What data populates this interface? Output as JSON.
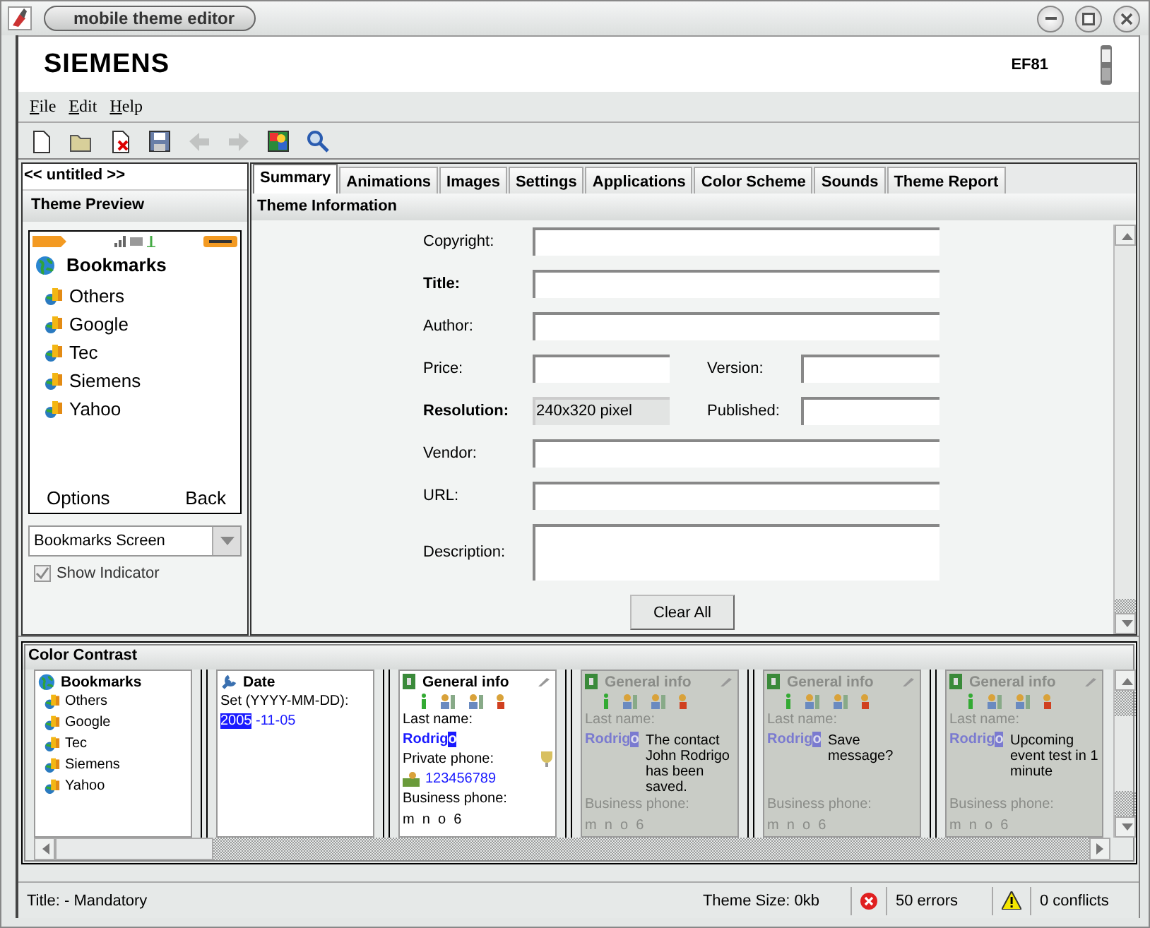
{
  "window": {
    "title": "mobile theme editor"
  },
  "banner": {
    "brand": "SIEMENS",
    "model": "EF81"
  },
  "menu": [
    "File",
    "Edit",
    "Help"
  ],
  "toolbar": [
    {
      "kind": "new",
      "disabled": false
    },
    {
      "kind": "open",
      "disabled": false
    },
    {
      "kind": "delete",
      "disabled": false
    },
    {
      "kind": "save",
      "disabled": false
    },
    {
      "kind": "back",
      "disabled": true
    },
    {
      "kind": "forward",
      "disabled": true
    },
    {
      "kind": "preview",
      "disabled": false
    },
    {
      "kind": "search",
      "disabled": false
    }
  ],
  "document": {
    "name": "<< untitled >>"
  },
  "preview": {
    "title": "Theme Preview",
    "screen": {
      "title": "Bookmarks",
      "items": [
        "Others",
        "Google",
        "Tec",
        "Siemens",
        "Yahoo"
      ],
      "softkeys": [
        "Options",
        "Back"
      ]
    },
    "screen_select": {
      "value": "Bookmarks Screen"
    },
    "show_indicator": {
      "label": "Show Indicator",
      "checked": true
    }
  },
  "tabs": [
    {
      "label": "Summary",
      "selected": true
    },
    {
      "label": "Animations",
      "selected": false
    },
    {
      "label": "Images",
      "selected": false
    },
    {
      "label": "Settings",
      "selected": false
    },
    {
      "label": "Applications",
      "selected": false
    },
    {
      "label": "Color Scheme",
      "selected": false
    },
    {
      "label": "Sounds",
      "selected": false
    },
    {
      "label": "Theme Report",
      "selected": false
    }
  ],
  "summary": {
    "title": "Theme Information",
    "rows": [
      {
        "kind": "wide",
        "fields": [
          {
            "label": "Copyright:",
            "bold": false,
            "readonly": false
          }
        ]
      },
      {
        "kind": "wide",
        "fields": [
          {
            "label": "Title:",
            "bold": true,
            "readonly": false
          }
        ]
      },
      {
        "kind": "wide",
        "fields": [
          {
            "label": "Author:",
            "bold": false,
            "readonly": false
          }
        ]
      },
      {
        "kind": "pair",
        "fields": [
          {
            "label": "Price:",
            "bold": false,
            "readonly": false
          },
          {
            "label": "Version:",
            "bold": false,
            "readonly": false
          }
        ]
      },
      {
        "kind": "pair",
        "fields": [
          {
            "label": "Resolution:",
            "bold": true,
            "readonly": true,
            "value": "240x320 pixel"
          },
          {
            "label": "Published:",
            "bold": false,
            "readonly": false
          }
        ]
      },
      {
        "kind": "wide",
        "fields": [
          {
            "label": "Vendor:",
            "bold": false,
            "readonly": false
          }
        ]
      },
      {
        "kind": "wide",
        "fields": [
          {
            "label": "URL:",
            "bold": false,
            "readonly": false
          }
        ]
      },
      {
        "kind": "area",
        "fields": [
          {
            "label": "Description:",
            "bold": false,
            "readonly": false
          }
        ]
      }
    ],
    "button": "Clear All"
  },
  "color_contrast": {
    "title": "Color Contrast",
    "panels": [
      {
        "kind": "list",
        "dimmed": false,
        "title": "Bookmarks",
        "items": [
          "Others",
          "Google",
          "Tec",
          "Siemens",
          "Yahoo"
        ]
      },
      {
        "kind": "date",
        "dimmed": false,
        "title": "Date",
        "label": "Set (YYYY-MM-DD):",
        "selected_part": "2005",
        "rest": "-11-05"
      },
      {
        "kind": "contact",
        "dimmed": false,
        "title": "General info",
        "last_name_label": "Last name:",
        "name": "Rodrig",
        "cursor": "o",
        "private_label": "Private phone:",
        "phone": "123456789",
        "business_label": "Business phone:",
        "keys": "m  n  o  6"
      },
      {
        "kind": "contact",
        "dimmed": true,
        "title": "General info",
        "last_name_label": "Last name:",
        "name": "Rodrig",
        "cursor": "o",
        "business_label": "Business phone:",
        "keys": "m  n  o  6",
        "message": "The contact John Rodrigo has been saved."
      },
      {
        "kind": "contact",
        "dimmed": true,
        "title": "General info",
        "last_name_label": "Last name:",
        "name": "Rodrig",
        "cursor": "o",
        "business_label": "Business phone:",
        "keys": "m  n  o  6",
        "message": "Save message?"
      },
      {
        "kind": "contact",
        "dimmed": true,
        "title": "General info",
        "last_name_label": "Last name:",
        "name": "Rodrig",
        "cursor": "o",
        "business_label": "Business phone:",
        "keys": "m  n  o  6",
        "message": "Upcoming event test in 1 minute"
      }
    ]
  },
  "status_bar": {
    "hint": "Title: - Mandatory",
    "size": "Theme Size: 0kb",
    "errors": "50 errors",
    "conflicts": "0 conflicts"
  }
}
